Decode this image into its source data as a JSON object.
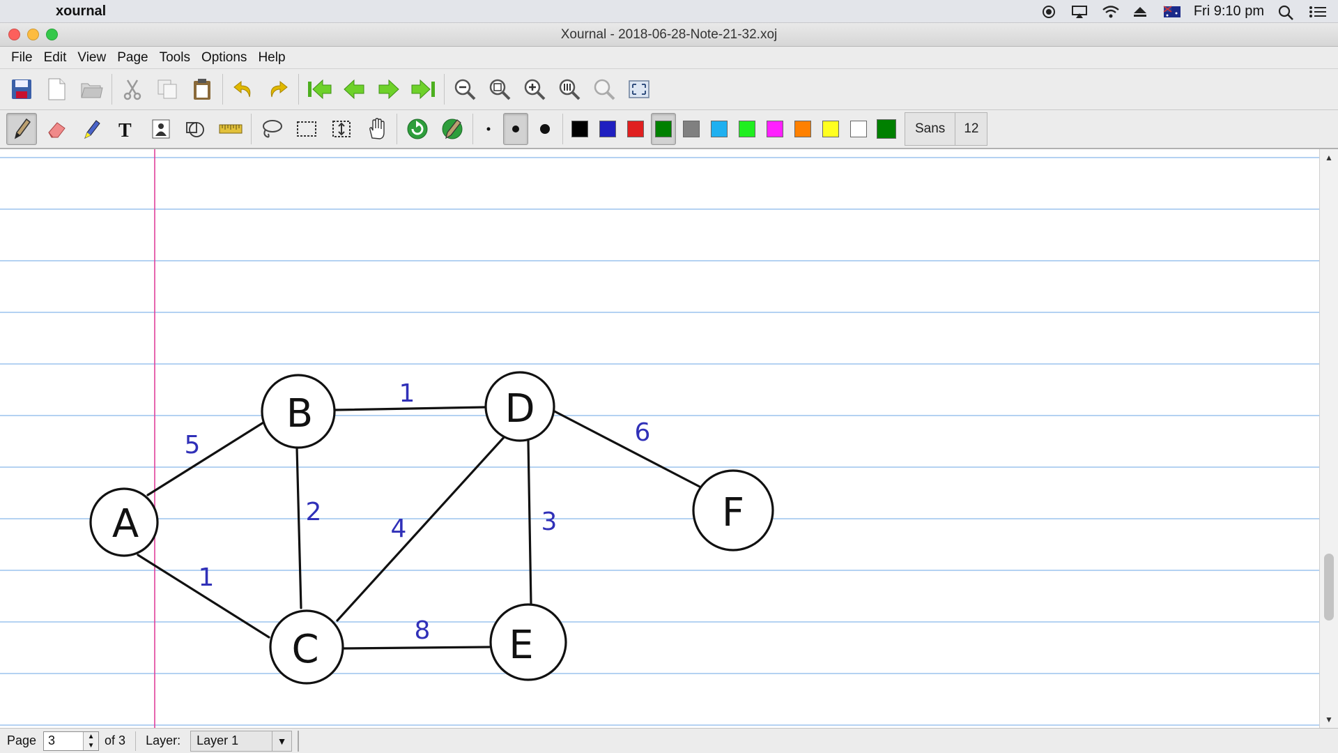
{
  "mac_menubar": {
    "app_name": "xournal",
    "clock": "Fri 9:10 pm"
  },
  "window": {
    "title": "Xournal - 2018-06-28-Note-21-32.xoj"
  },
  "menus": [
    "File",
    "Edit",
    "View",
    "Page",
    "Tools",
    "Options",
    "Help"
  ],
  "toolbar_main": [
    "save-icon",
    "new-page-icon",
    "open-folder-icon",
    "cut-icon",
    "copy-icon",
    "paste-icon",
    "undo-icon",
    "redo-icon",
    "first-page-icon",
    "previous-page-icon",
    "next-page-icon",
    "last-page-icon",
    "zoom-out-icon",
    "zoom-fit-page-icon",
    "zoom-in-icon",
    "zoom-100-icon",
    "zoom-width-icon",
    "fullscreen-icon"
  ],
  "toolbar_tools": {
    "font_name": "Sans",
    "font_size": "12",
    "colors": [
      "#000000",
      "#2020c0",
      "#e02020",
      "#008000",
      "#808080",
      "#20b0f0",
      "#20ee20",
      "#ff20ff",
      "#ff8000",
      "#ffff20",
      "#ffffff"
    ],
    "selected_color": "#008000",
    "current_color": "#008000"
  },
  "graph": {
    "nodes": [
      "A",
      "B",
      "C",
      "D",
      "E",
      "F"
    ],
    "edges": [
      {
        "from": "A",
        "to": "B",
        "weight": "5"
      },
      {
        "from": "A",
        "to": "C",
        "weight": "1"
      },
      {
        "from": "B",
        "to": "D",
        "weight": "1"
      },
      {
        "from": "B",
        "to": "C",
        "weight": "2"
      },
      {
        "from": "C",
        "to": "D",
        "weight": "4"
      },
      {
        "from": "D",
        "to": "E",
        "weight": "3"
      },
      {
        "from": "C",
        "to": "E",
        "weight": "8"
      },
      {
        "from": "D",
        "to": "F",
        "weight": "6"
      }
    ]
  },
  "statusbar": {
    "page_label": "Page",
    "page_value": "3",
    "page_of": "of 3",
    "layer_label": "Layer:",
    "layer_value": "Layer 1"
  }
}
